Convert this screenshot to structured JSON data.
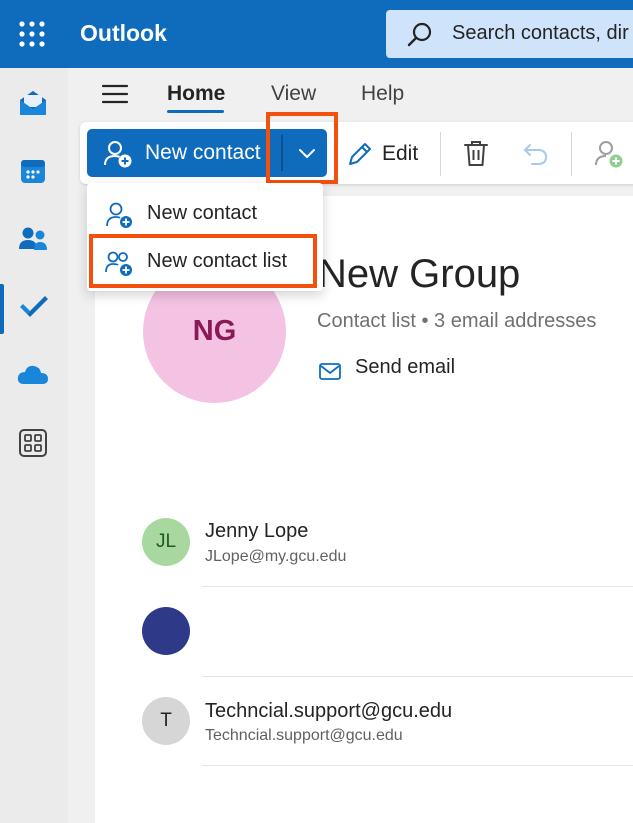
{
  "app": {
    "title": "Outlook"
  },
  "search": {
    "placeholder": "Search contacts, dir"
  },
  "tabs": [
    {
      "label": "Home",
      "active": true
    },
    {
      "label": "View",
      "active": false
    },
    {
      "label": "Help",
      "active": false
    }
  ],
  "rail": {
    "items": [
      "mail-icon",
      "calendar-icon",
      "people-icon",
      "todo-icon",
      "onedrive-icon",
      "apps-icon"
    ],
    "active": "people-icon"
  },
  "toolbar": {
    "new_contact": "New contact",
    "edit": "Edit"
  },
  "dropdown": {
    "items": [
      "New contact",
      "New contact list"
    ],
    "highlighted": "New contact list"
  },
  "group": {
    "initials": "NG",
    "name": "New Group",
    "subtitle": "Contact list • 3 email addresses",
    "send_email": "Send email"
  },
  "members": [
    {
      "initials": "JL",
      "name": "Jenny Lope",
      "email": "JLope@my.gcu.edu",
      "color": "#a8d8a0",
      "text_color": "#1e5a1e"
    },
    {
      "initials": "",
      "name": "",
      "email": "",
      "color": "#2e3a87",
      "text_color": "#ffffff"
    },
    {
      "initials": "T",
      "name": "Techncial.support@gcu.edu",
      "email": "Techncial.support@gcu.edu",
      "color": "#d6d6d6",
      "text_color": "#242424"
    }
  ],
  "colors": {
    "brand": "#0f6cbd",
    "highlight": "#f2500c",
    "avatar_group": "#f4c2e3"
  }
}
